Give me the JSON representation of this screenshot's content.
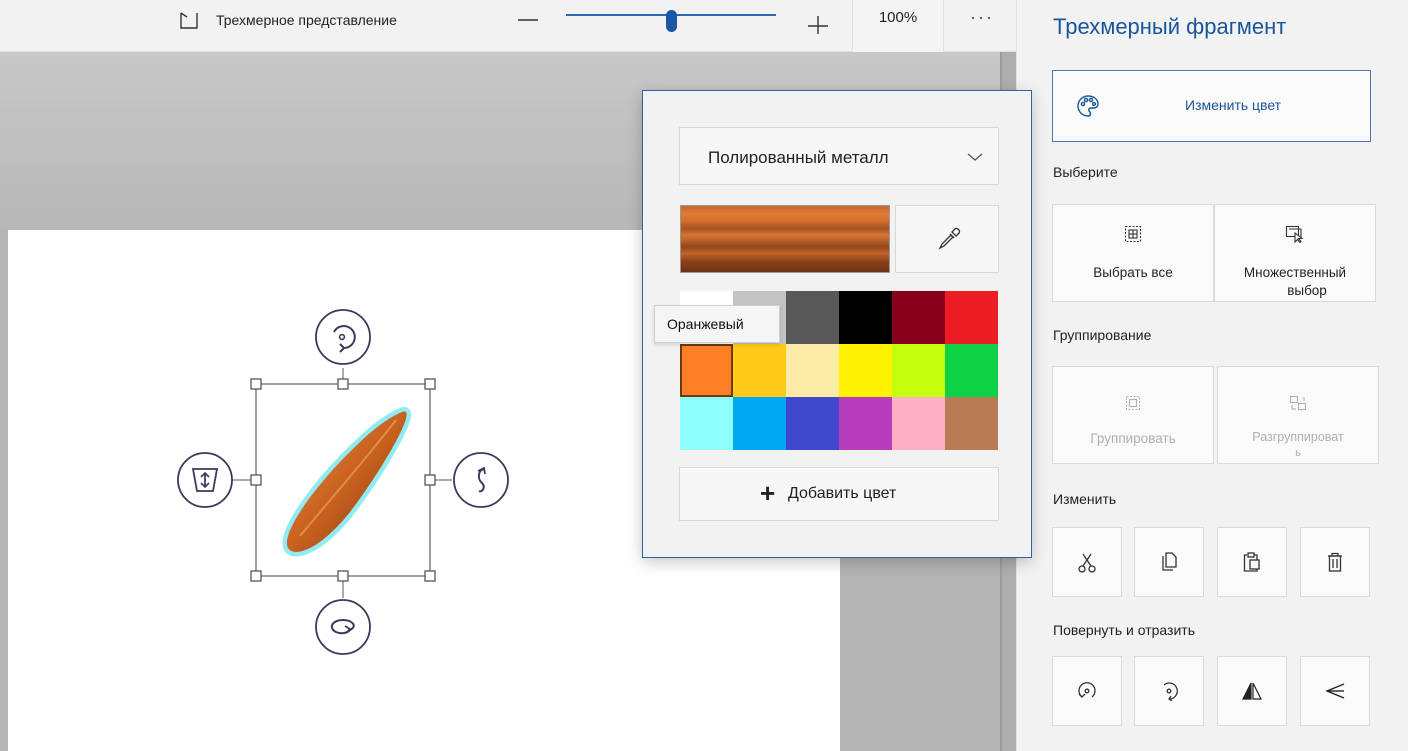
{
  "toolbar": {
    "view3d_label": "Трехмерное представление",
    "zoom_minus_icon": "minus-icon",
    "zoom_plus_icon": "plus-icon",
    "zoom_value": "100%",
    "zoom_level_percent": 100,
    "more_label": "···"
  },
  "panel": {
    "title": "Трехмерный фрагмент",
    "change_color_label": "Изменить цвет",
    "change_color_icon": "palette-icon",
    "select_heading": "Выберите",
    "select_all_label": "Выбрать все",
    "multi_select_label_1": "Множественный",
    "multi_select_label_2": "выбор",
    "group_heading": "Группирование",
    "group_label": "Группировать",
    "ungroup_label_1": "Разгруппироват",
    "ungroup_label_2": "ь",
    "edit_heading": "Изменить",
    "edit_icons": [
      "cut-icon",
      "copy-icon",
      "paste-icon",
      "delete-icon"
    ],
    "rotate_heading": "Повернуть и отразить",
    "rotate_icons": [
      "rotate-left-icon",
      "rotate-right-icon",
      "flip-horizontal-icon",
      "flip-vertical-icon"
    ]
  },
  "popup": {
    "material": "Полированный металл",
    "add_color_label": "Добавить цвет",
    "eyedropper_icon": "eyedropper-icon",
    "selected_index": 6,
    "swatches": [
      "#ffffff",
      "#c3c3c3",
      "#585858",
      "#000000",
      "#88001b",
      "#ec1c24",
      "#ff7f27",
      "#ffca18",
      "#fdeca6",
      "#fff200",
      "#c4ff0e",
      "#0ed145",
      "#8cfffb",
      "#00a8f3",
      "#3f48cc",
      "#b83dba",
      "#ffaec8",
      "#b97a56"
    ]
  },
  "tooltip": {
    "text": "Оранжевый"
  },
  "colors": {
    "accent": "#1a5599",
    "popup_border": "#2c62a8",
    "object_orange": "#d46a2a",
    "selection_glow": "#7ee8f0"
  }
}
